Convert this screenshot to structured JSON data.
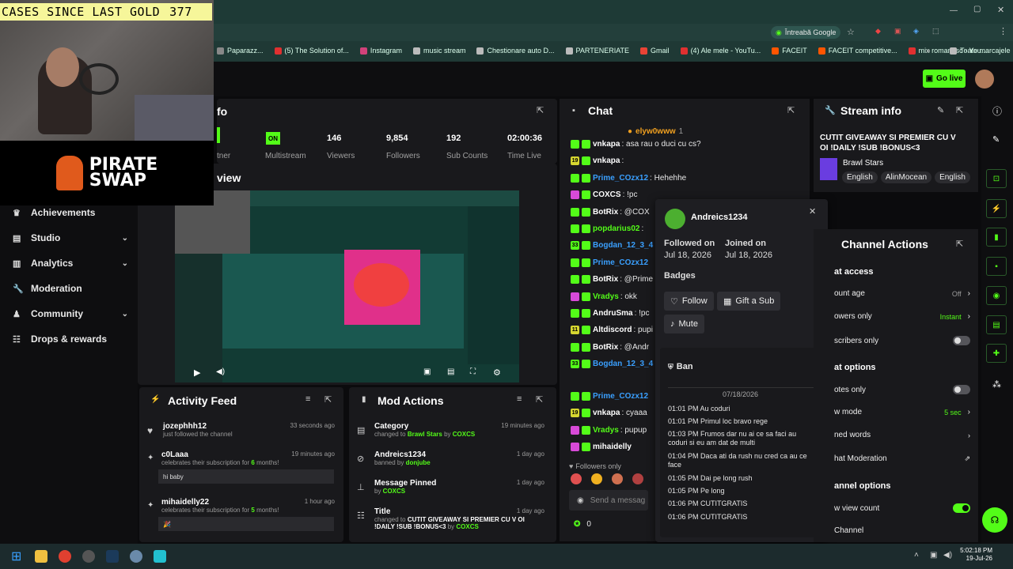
{
  "overlay": {
    "cases_text": "CASES SINCE LAST GOLD",
    "cases_count": "377",
    "brand_line1": "PIRATE",
    "brand_line2": "SWAP"
  },
  "browser": {
    "ask_google": "Întreabă Google",
    "bookmarks": [
      {
        "label": "Paparazz...",
        "color": "#888888"
      },
      {
        "label": "(5) The Solution of...",
        "color": "#e03030"
      },
      {
        "label": "Instagram",
        "color": "#d2427a"
      },
      {
        "label": "music stream",
        "color": "#bbbbbb"
      },
      {
        "label": "Chestionare auto D...",
        "color": "#bbbbbb"
      },
      {
        "label": "PARTENERIATE",
        "color": "#bbbbbb"
      },
      {
        "label": "Gmail",
        "color": "#ea4335"
      },
      {
        "label": "(4) Ale mele - YouTu...",
        "color": "#e03030"
      },
      {
        "label": "FACEIT",
        "color": "#ff5500"
      },
      {
        "label": "FACEIT competitive...",
        "color": "#ff5500"
      },
      {
        "label": "mix romanesc - You...",
        "color": "#e03030"
      }
    ],
    "bookmarks_all": "Toate marcajele"
  },
  "header": {
    "go_live": "Go live"
  },
  "sidebar": {
    "items": [
      {
        "label": "Achievements",
        "icon": "trophy-icon",
        "chev": ""
      },
      {
        "label": "Studio",
        "icon": "studio-icon",
        "chev": "v"
      },
      {
        "label": "Analytics",
        "icon": "analytics-icon",
        "chev": "v"
      },
      {
        "label": "Moderation",
        "icon": "wrench-icon",
        "chev": ""
      },
      {
        "label": "Community",
        "icon": "community-icon",
        "chev": "v"
      },
      {
        "label": "Drops & rewards",
        "icon": "drops-icon",
        "chev": ""
      }
    ]
  },
  "session": {
    "title_fragment": "fo",
    "stats": [
      {
        "value": "",
        "label": "tner"
      },
      {
        "value": "ON",
        "label": "Multistream"
      },
      {
        "value": "146",
        "label": "Viewers"
      },
      {
        "value": "9,854",
        "label": "Followers"
      },
      {
        "value": "192",
        "label": "Sub Counts"
      },
      {
        "value": "02:00:36",
        "label": "Time Live"
      }
    ],
    "preview_fragment": "view"
  },
  "activity": {
    "title": "Activity Feed",
    "rows": [
      {
        "name": "jozephhh12",
        "sub": "just followed the channel",
        "time": "33 seconds ago",
        "quote": ""
      },
      {
        "name": "c0Laaa",
        "sub_pre": "celebrates their subscription for ",
        "months": "6",
        "sub_post": " months!",
        "time": "19 minutes ago",
        "quote": "hi baby"
      },
      {
        "name": "mihaidelly22",
        "sub_pre": "celebrates their subscription for ",
        "months": "5",
        "sub_post": " months!",
        "time": "1 hour ago",
        "quote": "🎉"
      }
    ]
  },
  "mod": {
    "title": "Mod Actions",
    "rows": [
      {
        "name": "Category",
        "pre": "changed to ",
        "hl": "Brawl Stars",
        "by": " by ",
        "who": "COXCS",
        "time": "19 minutes ago"
      },
      {
        "name": "Andreics1234",
        "pre": "banned by ",
        "hl": "",
        "by": "",
        "who": "donjube",
        "time": "1 day ago"
      },
      {
        "name": "Message Pinned",
        "pre": "by ",
        "hl": "",
        "by": "",
        "who": "COXCS",
        "time": "1 day ago"
      },
      {
        "name": "Title",
        "pre": "changed to ",
        "hl": "CUTIT GIVEAWAY SI PREMIER CU V OI !DAILY !SUB !BONUS<3",
        "by": " by ",
        "who": "COXCS",
        "time": "1 day ago"
      }
    ]
  },
  "chat": {
    "title": "Chat",
    "pinned_user": "elyw0www",
    "pinned_count": "1",
    "messages": [
      {
        "user": "vnkapa",
        "text": ": asa rau o duci cu cs?",
        "color": "#ffffff",
        "badge": "#53fc18",
        "badge_txt": ""
      },
      {
        "user": "vnkapa",
        "text": ":",
        "color": "#ffffff",
        "badge": "#d6d630",
        "badge_txt": "19"
      },
      {
        "user": "Prime_COzx12",
        "text": ": Hehehhe",
        "color": "#3aa0ff",
        "badge": "#53fc18",
        "badge_txt": ""
      },
      {
        "user": "COXCS",
        "text": ": !pc",
        "color": "#ffffff",
        "badge": "#d84ad8",
        "badge_txt": ""
      },
      {
        "user": "BotRix",
        "text": ": @COX",
        "color": "#ffffff",
        "badge": "#53fc18",
        "badge_txt": ""
      },
      {
        "user": "popdarius02",
        "text": ":",
        "color": "#53fc18",
        "badge": "#53fc18",
        "badge_txt": ""
      },
      {
        "user": "Bogdan_12_3_4",
        "text": "",
        "color": "#3aa0ff",
        "badge": "#53fc18",
        "badge_txt": "33"
      },
      {
        "user": "Prime_COzx12",
        "text": "",
        "color": "#3aa0ff",
        "badge": "#53fc18",
        "badge_txt": ""
      },
      {
        "user": "BotRix",
        "text": ": @Prime",
        "color": "#ffffff",
        "badge": "#53fc18",
        "badge_txt": ""
      },
      {
        "user": "Vradys",
        "text": ": okk",
        "color": "#53fc18",
        "badge": "#d84ad8",
        "badge_txt": ""
      },
      {
        "user": "AndruSma",
        "text": ": !pc",
        "color": "#ffffff",
        "badge": "#53fc18",
        "badge_txt": ""
      },
      {
        "user": "Altdiscord",
        "text": ": pupi",
        "color": "#ffffff",
        "badge": "#d6d630",
        "badge_txt": "11"
      },
      {
        "user": "BotRix",
        "text": ": @Andr",
        "color": "#ffffff",
        "badge": "#53fc18",
        "badge_txt": ""
      },
      {
        "user": "Bogdan_12_3_4",
        "text": "",
        "color": "#3aa0ff",
        "badge": "#53fc18",
        "badge_txt": "33"
      }
    ],
    "messages2": [
      {
        "user": "Prime_COzx12",
        "text": "",
        "color": "#3aa0ff",
        "badge": "#53fc18",
        "badge_txt": ""
      },
      {
        "user": "vnkapa",
        "text": ": cyaaa",
        "color": "#ffffff",
        "badge": "#d6d630",
        "badge_txt": "19"
      },
      {
        "user": "Vradys",
        "text": ": pupup",
        "color": "#53fc18",
        "badge": "#d84ad8",
        "badge_txt": ""
      },
      {
        "user": "mihaidelly",
        "text": "",
        "color": "#ffffff",
        "badge": "#d84ad8",
        "badge_txt": ""
      }
    ],
    "followers_only": "Followers only",
    "input_placeholder": "Send a messag",
    "count": "0"
  },
  "popup": {
    "username": "Andreics1234",
    "followed_label": "Followed on",
    "followed_date": "Jul 18, 2026",
    "joined_label": "Joined on",
    "joined_date": "Jul 18, 2026",
    "badges_label": "Badges",
    "follow": "Follow",
    "gift": "Gift a Sub",
    "mute": "Mute",
    "ban": "Ban",
    "log_date": "07/18/2026",
    "log": [
      "01:01 PM Au coduri",
      "01:01 PM Primul loc bravo rege",
      "01:03 PM Frumos dar nu ai ce sa faci au coduri si eu am dat de multi",
      "01:04 PM Daca ati da rush nu cred ca au ce face",
      "01:05 PM Dai pe long rush",
      "01:05 PM Pe long",
      "01:06 PM CUTITGRATIS",
      "01:06 PM CUTITGRATIS"
    ]
  },
  "stream_info": {
    "title": "Stream info",
    "stream_title": "CUTIT GIVEAWAY SI PREMIER CU V OI !DAILY !SUB !BONUS<3",
    "game": "Brawl Stars",
    "tags": [
      "English",
      "AlinMocean",
      "English"
    ]
  },
  "channel_actions": {
    "title": "Channel Actions",
    "sec1": "at access",
    "r1": "ount age",
    "r1v": "Off",
    "r2": "owers only",
    "r2v": "Instant",
    "r3": "scribers only",
    "sec2": "at options",
    "r4": "otes only",
    "r5": "w mode",
    "r5v": "5 sec",
    "r6": "ned words",
    "r7": "hat Moderation",
    "sec3": "annel options",
    "r8": "w view count",
    "r9": "Channel"
  },
  "taskbar": {
    "time": "5:02:18 PM",
    "date": "19-Jul-26"
  }
}
